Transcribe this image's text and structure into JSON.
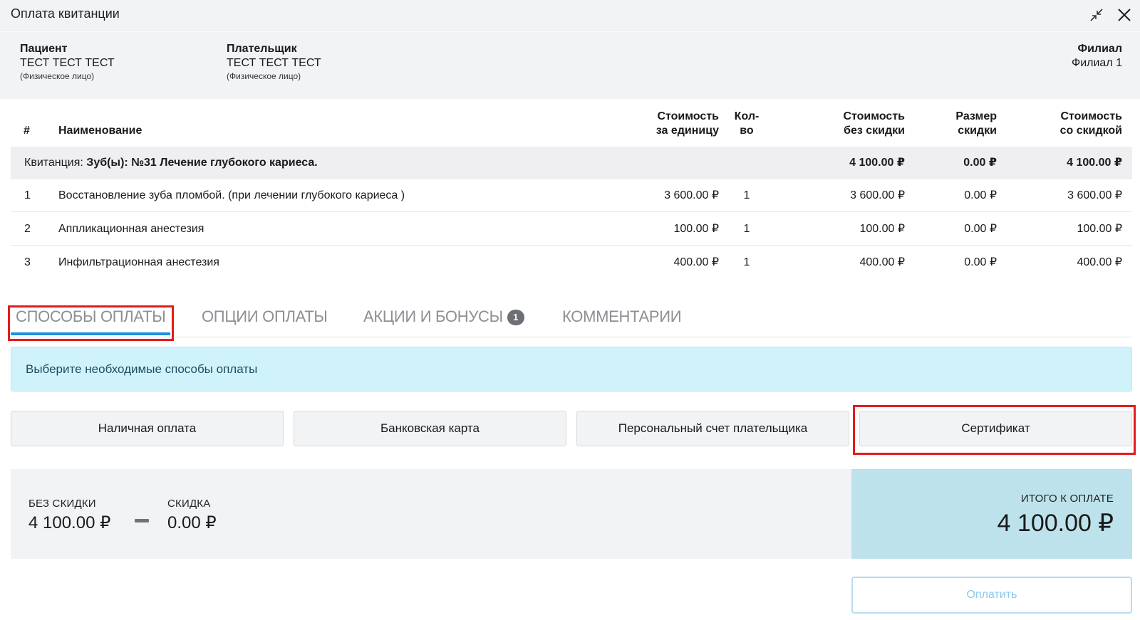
{
  "window": {
    "title": "Оплата квитанции"
  },
  "info": {
    "patient": {
      "label": "Пациент",
      "name": "ТЕСТ ТЕСТ ТЕСТ",
      "type": "(Физическое лицо)"
    },
    "payer": {
      "label": "Плательщик",
      "name": "ТЕСТ ТЕСТ ТЕСТ",
      "type": "(Физическое лицо)"
    },
    "branch": {
      "label": "Филиал",
      "name": "Филиал 1"
    }
  },
  "table": {
    "headers": {
      "num": "#",
      "name": "Наименование",
      "unit_price": [
        "Стоимость",
        "за единицу"
      ],
      "qty": [
        "Кол-",
        "во"
      ],
      "no_discount": [
        "Стоимость",
        "без скидки"
      ],
      "discount": [
        "Размер",
        "скидки"
      ],
      "with_discount": [
        "Стоимость",
        "со скидкой"
      ]
    },
    "group": {
      "prefix": "Квитанция: ",
      "title": "Зуб(ы): №31 Лечение глубокого кариеса.",
      "no_discount": "4 100.00 ₽",
      "discount": "0.00 ₽",
      "with_discount": "4 100.00 ₽"
    },
    "rows": [
      {
        "num": "1",
        "name": "Восстановление зуба пломбой. (при лечении глубокого кариеса )",
        "unit_price": "3 600.00 ₽",
        "qty": "1",
        "no_discount": "3 600.00 ₽",
        "discount": "0.00 ₽",
        "with_discount": "3 600.00 ₽"
      },
      {
        "num": "2",
        "name": "Аппликационная анестезия",
        "unit_price": "100.00 ₽",
        "qty": "1",
        "no_discount": "100.00 ₽",
        "discount": "0.00 ₽",
        "with_discount": "100.00 ₽"
      },
      {
        "num": "3",
        "name": "Инфильтрационная анестезия",
        "unit_price": "400.00 ₽",
        "qty": "1",
        "no_discount": "400.00 ₽",
        "discount": "0.00 ₽",
        "with_discount": "400.00 ₽"
      }
    ]
  },
  "tabs": [
    {
      "label": "СПОСОБЫ ОПЛАТЫ",
      "active": true
    },
    {
      "label": "ОПЦИИ ОПЛАТЫ",
      "active": false
    },
    {
      "label": "АКЦИИ И БОНУСЫ",
      "badge": "1",
      "active": false
    },
    {
      "label": "КОММЕНТАРИИ",
      "active": false
    }
  ],
  "alert": {
    "text": "Выберите необходимые способы оплаты"
  },
  "payment_methods": [
    {
      "label": "Наличная оплата"
    },
    {
      "label": "Банковская карта"
    },
    {
      "label": "Персональный счет плательщика"
    },
    {
      "label": "Сертификат"
    }
  ],
  "summary": {
    "no_discount_label": "БЕЗ СКИДКИ",
    "no_discount_value": "4 100.00 ₽",
    "discount_label": "СКИДКА",
    "discount_value": "0.00 ₽",
    "total_label": "ИТОГО К ОПЛАТЕ",
    "total_value": "4 100.00 ₽"
  },
  "actions": {
    "pay_label": "Оплатить"
  },
  "colors": {
    "accent": "#1e8fe0",
    "highlight": "#e41b1b",
    "alert_bg": "#d0f3fb",
    "total_bg": "#bde2eb"
  }
}
